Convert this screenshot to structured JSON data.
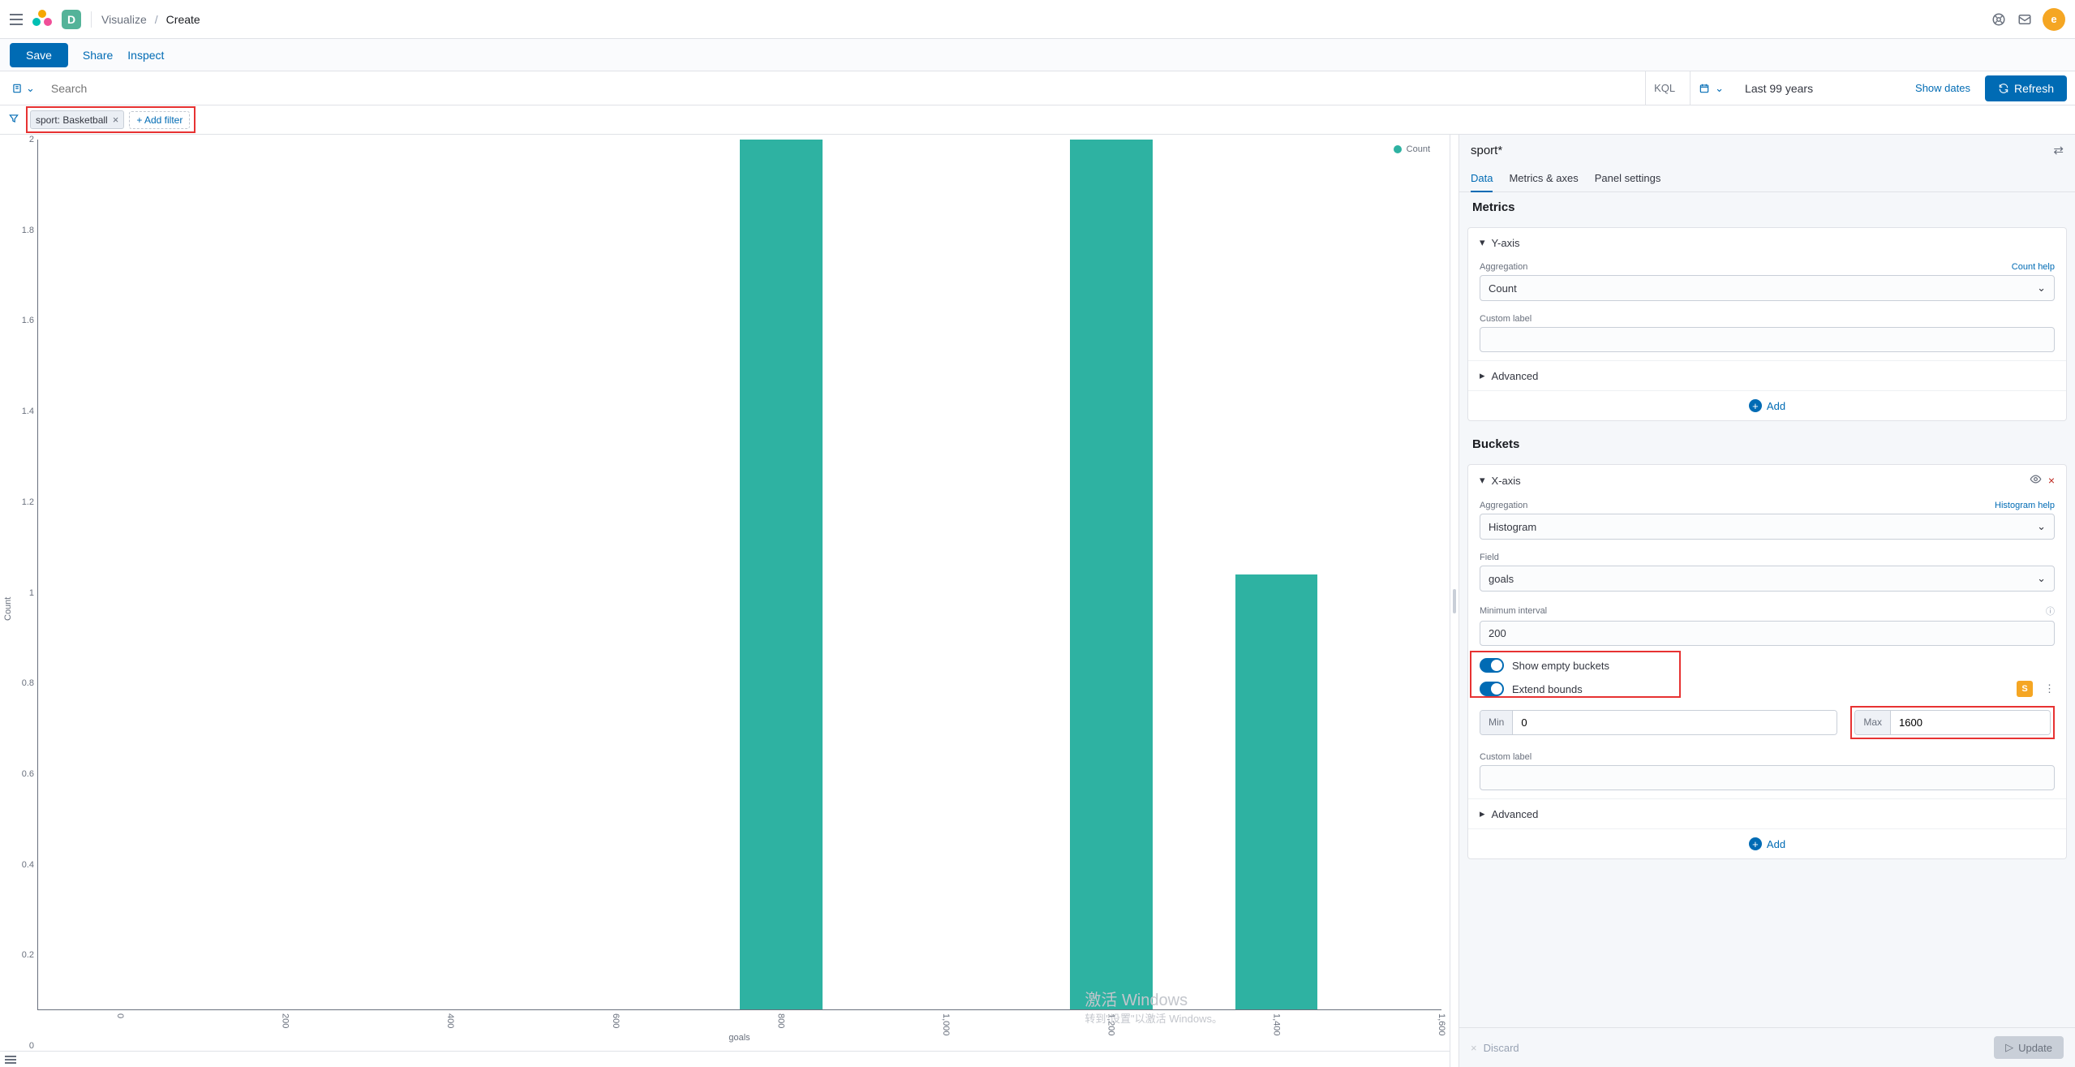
{
  "nav": {
    "space_letter": "D",
    "breadcrumb_parent": "Visualize",
    "breadcrumb_current": "Create",
    "avatar_letter": "e"
  },
  "actionbar": {
    "save": "Save",
    "share": "Share",
    "inspect": "Inspect"
  },
  "querybar": {
    "search_placeholder": "Search",
    "kql": "KQL",
    "date_range": "Last 99 years",
    "show_dates": "Show dates",
    "refresh": "Refresh"
  },
  "filterbar": {
    "pill": "sport: Basketball",
    "add_filter": "+ Add filter"
  },
  "chart_data": {
    "type": "bar",
    "title": "",
    "xlabel": "goals",
    "ylabel": "Count",
    "legend": "Count",
    "x_ticks": [
      "0",
      "200",
      "400",
      "600",
      "800",
      "1,000",
      "1,200",
      "1,400",
      "1,600"
    ],
    "y_ticks": [
      "0",
      "0.2",
      "0.4",
      "0.6",
      "0.8",
      "1",
      "1.2",
      "1.4",
      "1.6",
      "1.8",
      "2"
    ],
    "xlim": [
      0,
      1700
    ],
    "ylim": [
      0,
      2
    ],
    "categories": [
      0,
      200,
      400,
      600,
      800,
      1000,
      1200,
      1400,
      1600
    ],
    "values": [
      0,
      0,
      0,
      0,
      2,
      0,
      2,
      1,
      0
    ],
    "bar_color": "#2eb2a2"
  },
  "sidebar": {
    "index_pattern": "sport*",
    "tabs": {
      "data": "Data",
      "metrics_axes": "Metrics & axes",
      "panel_settings": "Panel settings"
    },
    "metrics": {
      "title": "Metrics",
      "axis_label": "Y-axis",
      "aggregation_label": "Aggregation",
      "aggregation_help": "Count help",
      "aggregation_value": "Count",
      "custom_label": "Custom label",
      "advanced": "Advanced",
      "add": "Add"
    },
    "buckets": {
      "title": "Buckets",
      "axis_label": "X-axis",
      "aggregation_label": "Aggregation",
      "aggregation_help": "Histogram help",
      "aggregation_value": "Histogram",
      "field_label": "Field",
      "field_value": "goals",
      "min_interval_label": "Minimum interval",
      "min_interval_value": "200",
      "show_empty": "Show empty buckets",
      "extend_bounds": "Extend bounds",
      "min_label": "Min",
      "min_value": "0",
      "max_label": "Max",
      "max_value": "1600",
      "custom_label": "Custom label",
      "advanced": "Advanced",
      "add": "Add"
    },
    "footer": {
      "discard": "Discard",
      "update": "Update"
    }
  },
  "watermark": {
    "line1": "激活 Windows",
    "line2": "转到\"设置\"以激活 Windows。"
  }
}
